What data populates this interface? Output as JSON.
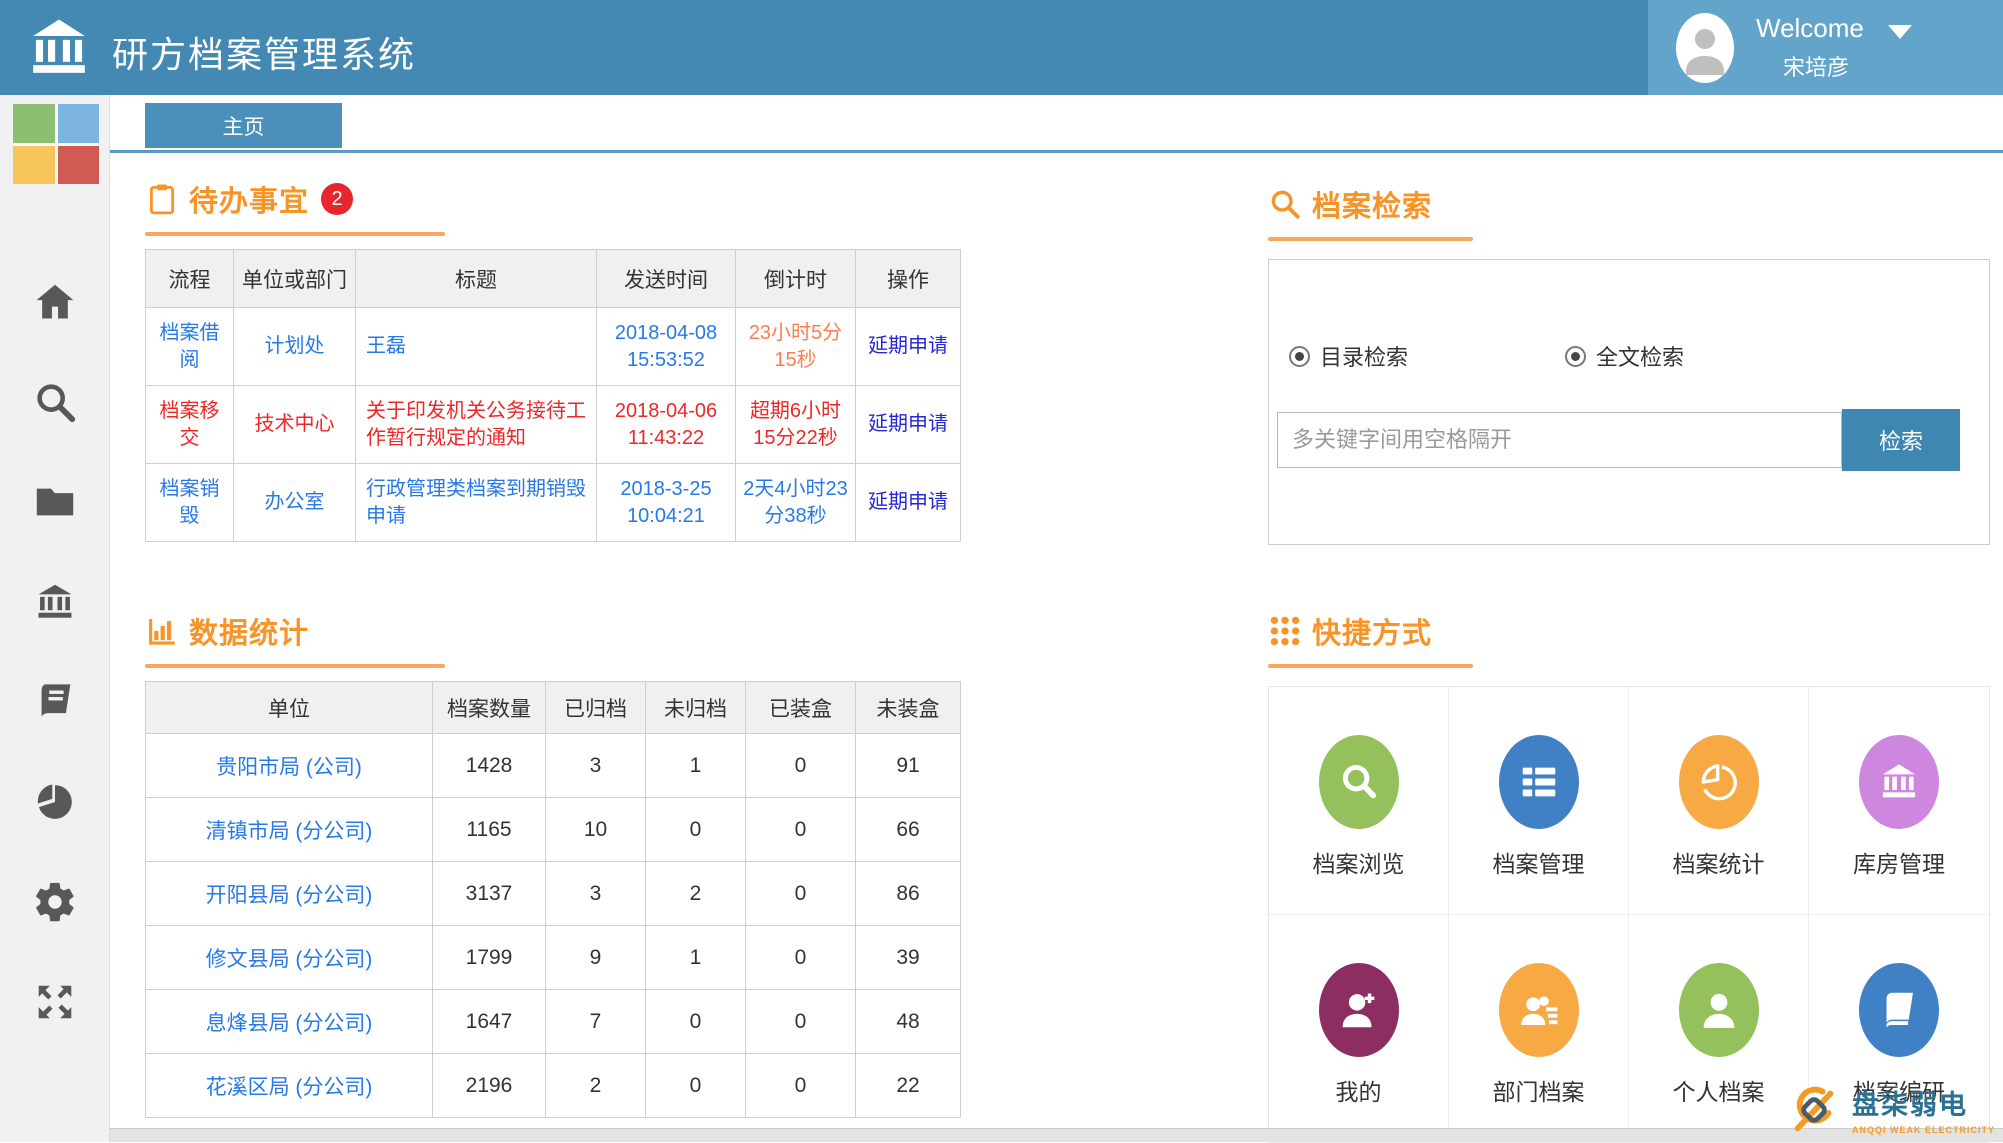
{
  "colors": {
    "header_blue": "#4389b3",
    "user_panel_blue": "#63a4cb",
    "tab_blue": "#4a90ba",
    "accent_orange": "#f79428",
    "badge_red": "#e6252c",
    "link_blue": "#2779e8",
    "alert_red": "#f02626",
    "countdown_orange": "#ff7d4d",
    "action_link_blue": "#2626d9",
    "search_button_blue": "#3d87b0"
  },
  "header": {
    "app_title": "研方档案管理系统",
    "welcome": "Welcome",
    "username": "宋培彦"
  },
  "tabs": {
    "home": "主页"
  },
  "sidebar": {
    "icons": [
      "home",
      "search",
      "folder",
      "archive-bank",
      "book",
      "pie-chart",
      "settings-gear",
      "fullscreen-expand"
    ]
  },
  "todo": {
    "title": "待办事宜",
    "badge": "2",
    "columns": [
      "流程",
      "单位或部门",
      "标题",
      "发送时间",
      "倒计时",
      "操作"
    ],
    "rows": [
      {
        "flow": "档案借阅",
        "dept": "计划处",
        "subject": "王磊",
        "sent": "2018-04-08 15:53:52",
        "countdown": "23小时5分15秒",
        "action": "延期申请"
      },
      {
        "flow": "档案移交",
        "dept": "技术中心",
        "subject": "关于印发机关公务接待工作暂行规定的通知",
        "sent": "2018-04-06 11:43:22",
        "countdown": "超期6小时15分22秒",
        "action": "延期申请"
      },
      {
        "flow": "档案销毁",
        "dept": "办公室",
        "subject": "行政管理类档案到期销毁申请",
        "sent": "2018-3-25 10:04:21",
        "countdown": "2天4小时23分38秒",
        "action": "延期申请"
      }
    ]
  },
  "search": {
    "title": "档案检索",
    "radios": [
      {
        "label": "目录检索",
        "selected": true
      },
      {
        "label": "全文检索",
        "selected": true
      }
    ],
    "placeholder": "多关键字间用空格隔开",
    "button": "检索"
  },
  "stats": {
    "title": "数据统计",
    "columns": [
      "单位",
      "档案数量",
      "已归档",
      "未归档",
      "已装盒",
      "未装盒"
    ],
    "rows": [
      {
        "unit": "贵阳市局 (公司)",
        "total": "1428",
        "archived": "3",
        "unarchived": "1",
        "boxed": "0",
        "unboxed": "91"
      },
      {
        "unit": "清镇市局 (分公司)",
        "total": "1165",
        "archived": "10",
        "unarchived": "0",
        "boxed": "0",
        "unboxed": "66"
      },
      {
        "unit": "开阳县局 (分公司)",
        "total": "3137",
        "archived": "3",
        "unarchived": "2",
        "boxed": "0",
        "unboxed": "86"
      },
      {
        "unit": "修文县局 (分公司)",
        "total": "1799",
        "archived": "9",
        "unarchived": "1",
        "boxed": "0",
        "unboxed": "39"
      },
      {
        "unit": "息烽县局 (分公司)",
        "total": "1647",
        "archived": "7",
        "unarchived": "0",
        "boxed": "0",
        "unboxed": "48"
      },
      {
        "unit": "花溪区局 (分公司)",
        "total": "2196",
        "archived": "2",
        "unarchived": "0",
        "boxed": "0",
        "unboxed": "22"
      }
    ]
  },
  "shortcuts": {
    "title": "快捷方式",
    "items": [
      {
        "label": "档案浏览",
        "icon": "search-icon",
        "color": "#94c15c"
      },
      {
        "label": "档案管理",
        "icon": "table-icon",
        "color": "#4080c4"
      },
      {
        "label": "档案统计",
        "icon": "pie-icon",
        "color": "#f7a943"
      },
      {
        "label": "库房管理",
        "icon": "bank-icon",
        "color": "#cd87de"
      },
      {
        "label": "我的",
        "icon": "person-plus-icon",
        "color": "#8c2e62"
      },
      {
        "label": "部门档案",
        "icon": "people-list-icon",
        "color": "#f7a943"
      },
      {
        "label": "个人档案",
        "icon": "person-icon",
        "color": "#94c15c"
      },
      {
        "label": "档案编研",
        "icon": "book-icon",
        "color": "#4080c4"
      }
    ]
  },
  "watermark": {
    "name": "盘柒弱电",
    "subtitle": "ANQQI WEAK ELECTRICITY"
  }
}
